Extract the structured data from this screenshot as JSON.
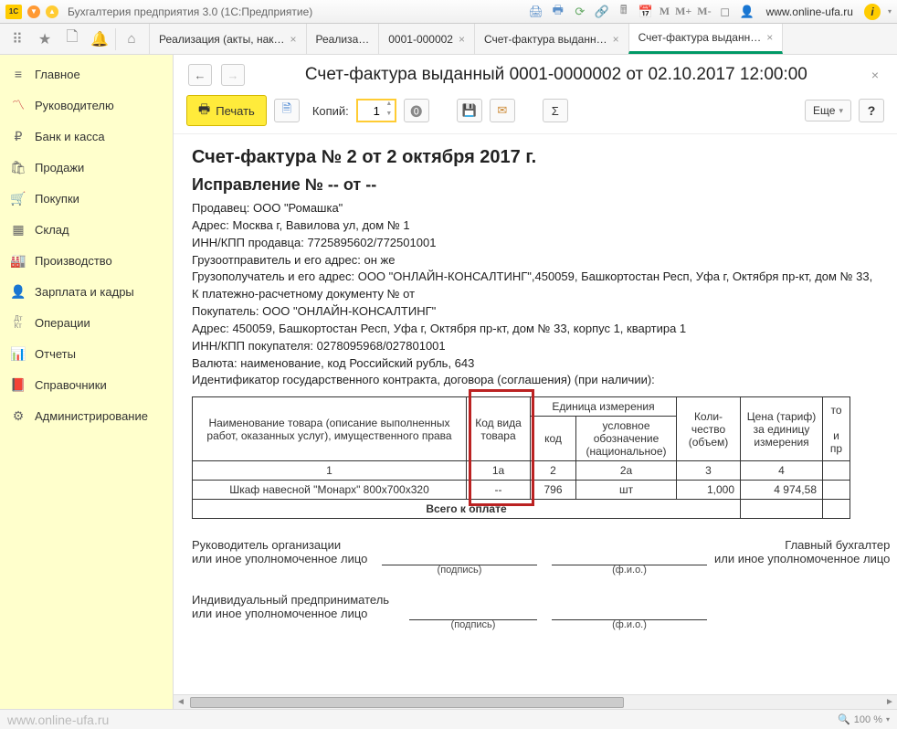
{
  "titlebar": {
    "app_title": "Бухгалтерия предприятия 3.0  (1С:Предприятие)",
    "url": "www.online-ufa.ru",
    "m_labels": [
      "M",
      "M+",
      "M-"
    ]
  },
  "tabs": [
    {
      "label": "Реализация (акты, нак…"
    },
    {
      "label": "Реализа…"
    },
    {
      "label": "0001-000002"
    },
    {
      "label": "Счет-фактура выданн…"
    },
    {
      "label": "Счет-фактура выданн…",
      "active": true
    }
  ],
  "sidebar": {
    "items": [
      {
        "icon": "≡",
        "label": "Главное"
      },
      {
        "icon": "📈",
        "label": "Руководителю"
      },
      {
        "icon": "₽",
        "label": "Банк и касса"
      },
      {
        "icon": "🛍",
        "label": "Продажи"
      },
      {
        "icon": "🛒",
        "label": "Покупки"
      },
      {
        "icon": "▦",
        "label": "Склад"
      },
      {
        "icon": "🏭",
        "label": "Производство"
      },
      {
        "icon": "👤",
        "label": "Зарплата и кадры"
      },
      {
        "icon": "Дт\nКт",
        "label": "Операции"
      },
      {
        "icon": "📊",
        "label": "Отчеты"
      },
      {
        "icon": "📕",
        "label": "Справочники"
      },
      {
        "icon": "⚙",
        "label": "Администрирование"
      }
    ]
  },
  "doc": {
    "title": "Счет-фактура выданный 0001-0000002 от 02.10.2017 12:00:00",
    "print_label": "Печать",
    "copies_label": "Копий:",
    "copies_value": "1",
    "more_label": "Еще",
    "help_label": "?"
  },
  "invoice": {
    "title": "Счет-фактура № 2 от 2 октября 2017 г.",
    "subtitle": "Исправление № -- от --",
    "seller": "Продавец: ООО \"Ромашка\"",
    "seller_addr": "Адрес: Москва г, Вавилова ул, дом № 1",
    "seller_inn": "ИНН/КПП продавца: 7725895602/772501001",
    "shipper": "Грузоотправитель и его адрес: он же",
    "consignee": "Грузополучатель и его адрес: ООО \"ОНЛАЙН-КОНСАЛТИНГ\",450059, Башкортостан Респ, Уфа г, Октября пр-кт, дом № 33,",
    "payment_doc": "К платежно-расчетному документу № от",
    "buyer": "Покупатель: ООО \"ОНЛАЙН-КОНСАЛТИНГ\"",
    "buyer_addr": "Адрес: 450059, Башкортостан Респ, Уфа г, Октября пр-кт, дом № 33, корпус 1, квартира 1",
    "buyer_inn": "ИНН/КПП покупателя: 0278095968/027801001",
    "currency": "Валюта: наименование, код Российский рубль, 643",
    "contract_id": "Идентификатор государственного контракта, договора (соглашения) (при наличии):",
    "headers": {
      "name": "Наименование товара (описание выполненных работ, оказанных услуг), имущественного права",
      "code_type": "Код вида товара",
      "unit": "Единица измерения",
      "unit_code": "код",
      "unit_name": "условное обозначение (национальное)",
      "qty": "Коли-чество (объем)",
      "price": "Цена (тариф) за единицу измерения",
      "cost": "то",
      "cost2": "и пр"
    },
    "col_nums": [
      "1",
      "1а",
      "2",
      "2а",
      "3",
      "4"
    ],
    "row": {
      "name": "Шкаф навесной \"Монарх\" 800x700x320",
      "code_type": "--",
      "unit_code": "796",
      "unit_name": "шт",
      "qty": "1,000",
      "price": "4 974,58"
    },
    "total_label": "Всего к оплате",
    "sign": {
      "head": "Руководитель организации",
      "head2": "или иное уполномоченное лицо",
      "podp": "(подпись)",
      "fio": "(ф.и.о.)",
      "acc": "Главный бухгалтер",
      "acc2": "или иное уполномоченное лицо",
      "ip": "Индивидуальный предприниматель",
      "ip2": "или иное уполномоченное лицо"
    }
  },
  "statusbar": {
    "watermark": "www.online-ufa.ru",
    "zoom": "100 %"
  }
}
